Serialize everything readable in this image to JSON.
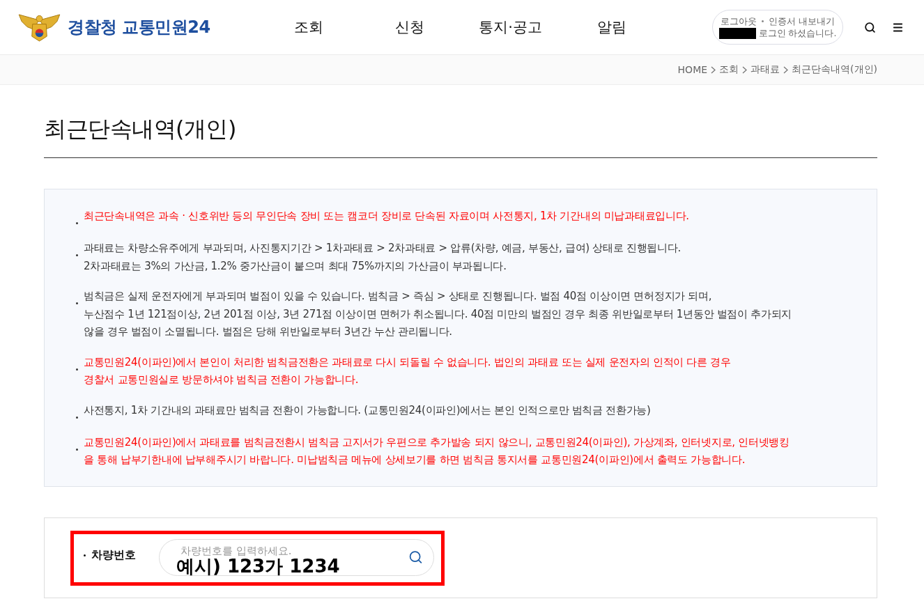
{
  "header": {
    "logo": {
      "text": "경찰청 교통민원24"
    },
    "nav": [
      {
        "label": "조회"
      },
      {
        "label": "신청"
      },
      {
        "label": "통지·공고"
      },
      {
        "label": "알림"
      }
    ],
    "account": {
      "links": [
        "로그아웃",
        "인증서 내보내기"
      ],
      "name_hidden": true,
      "status": "로그인 하셨습니다."
    }
  },
  "breadcrumb": [
    "HOME",
    "조회",
    "과태료",
    "최근단속내역(개인)"
  ],
  "page_title": "최근단속내역(개인)",
  "notices": [
    {
      "kind": "alert",
      "lines": [
        "최근단속내역은 과속 · 신호위반 등의 무인단속 장비 또는 캠코더 장비로 단속된 자료이며 사전통지, 1차 기간내의 미납과태료입니다."
      ]
    },
    {
      "kind": "info",
      "lines": [
        "과태료는 차량소유주에게 부과되며, 사진통지기간 > 1차과태료 > 2차과태료 > 압류(차량, 예금, 부동산, 급여) 상태로 진행됩니다.",
        "2차과태료는 3%의 가산금, 1.2% 중가산금이 붙으며 최대 75%까지의 가산금이 부과됩니다."
      ]
    },
    {
      "kind": "info",
      "lines": [
        "범칙금은 실제 운전자에게 부과되며 벌점이 있을 수 있습니다. 범칙금 > 즉심 > 상태로 진행됩니다. 벌점 40점 이상이면 면허정지가 되며,",
        "누산점수 1년 121점이상, 2년 201점 이상, 3년 271점 이상이면 면허가 취소됩니다. 40점 미만의 벌점인 경우 최종 위반일로부터 1년동안 벌점이 추가되지",
        "않을 경우 벌점이 소멸됩니다. 벌점은 당해 위반일로부터 3년간 누산 관리됩니다."
      ]
    },
    {
      "kind": "alert",
      "lines": [
        "교통민원24(이파인)에서 본인이 처리한 범칙금전환은 과태료로 다시 되돌릴 수 없습니다. 법인의 과태료 또는 실제 운전자의 인적이 다른 경우",
        "경찰서 교통민원실로 방문하셔야 범칙금 전환이 가능합니다."
      ]
    },
    {
      "kind": "info",
      "lines": [
        "사전통지, 1차 기간내의 과태료만 범칙금 전환이 가능합니다. (교통민원24(이파인)에서는 본인 인적으로만 범칙금 전환가능)"
      ]
    },
    {
      "kind": "alert",
      "lines": [
        "교통민원24(이파인)에서 과태료를 범칙금전환시 범칙금 고지서가 우편으로 추가발송 되지 않으니, 교통민원24(이파인), 가상계좌, 인터넷지로, 인터넷뱅킹",
        "을 통해 납부기한내에 납부해주시기 바랍니다. 미납범칙금 메뉴에 상세보기를 하면 범칙금 통지서를 교통민원24(이파인)에서 출력도 가능합니다."
      ]
    }
  ],
  "search": {
    "label": "차량번호",
    "placeholder": "차량번호를 입력하세요.",
    "highlighted": true,
    "annotation": "예시) 123가 1234"
  }
}
